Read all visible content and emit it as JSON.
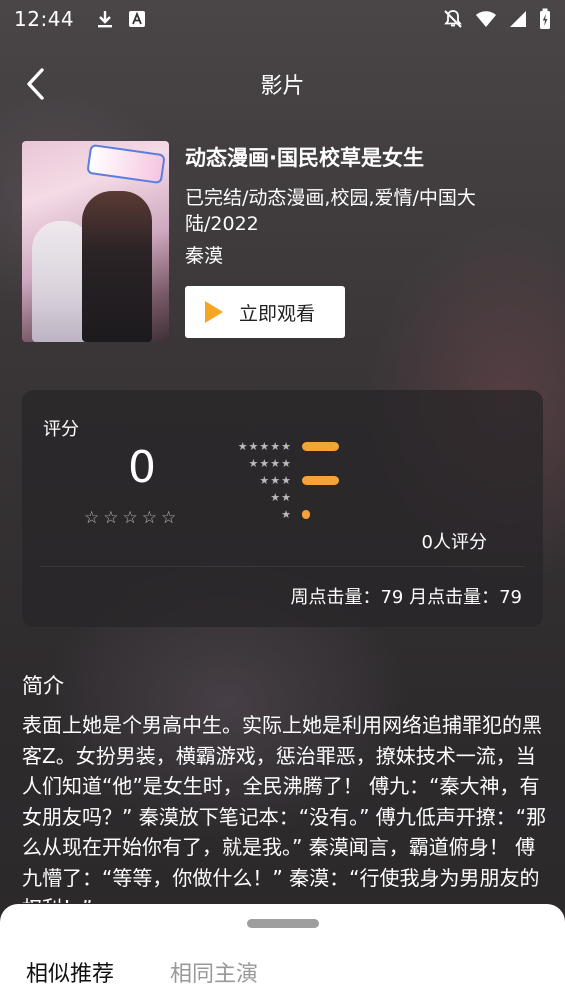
{
  "status_bar": {
    "time": "12:44",
    "left_icons": [
      "download-icon",
      "a-icon"
    ],
    "right_icons": [
      "notifications-off-icon",
      "wifi-icon",
      "signal-icon",
      "battery-icon"
    ]
  },
  "nav": {
    "title": "影片"
  },
  "movie": {
    "title": "动态漫画·国民校草是女生",
    "meta": "已完结/动态漫画,校园,爱情/中国大陆/2022",
    "actor": "秦漠",
    "watch_label": "立即观看"
  },
  "rating": {
    "label": "评分",
    "score": "0",
    "distribution": [
      {
        "stars": "★★★★★",
        "fraction": 1.0
      },
      {
        "stars": "★★★★",
        "fraction": 0.0
      },
      {
        "stars": "★★★",
        "fraction": 1.0
      },
      {
        "stars": "★★",
        "fraction": 0.0
      },
      {
        "stars": "★",
        "fraction": 0.22
      }
    ],
    "count_text": "0人评分",
    "clicks_text": "周点击量：79  月点击量：79"
  },
  "intro": {
    "title": "简介",
    "text": "表面上她是个男高中生。实际上她是利用网络追捕罪犯的黑客Z。女扮男装，横霸游戏，惩治罪恶，撩妹技术一流，当人们知道“他”是女生时，全民沸腾了！ 傅九：“秦大神，有女朋友吗？” 秦漠放下笔记本：“没有。” 傅九低声开撩：“那么从现在开始你有了，就是我。” 秦漠闻言，霸道俯身！ 傅九懵了：“等等，你做什么！” 秦漠：“行使我身为男朋友的权利！”"
  },
  "sheet": {
    "tabs": [
      "相似推荐",
      "相同主演"
    ]
  },
  "colors": {
    "accent": "#f5a623",
    "bar": "#f2a43a"
  }
}
